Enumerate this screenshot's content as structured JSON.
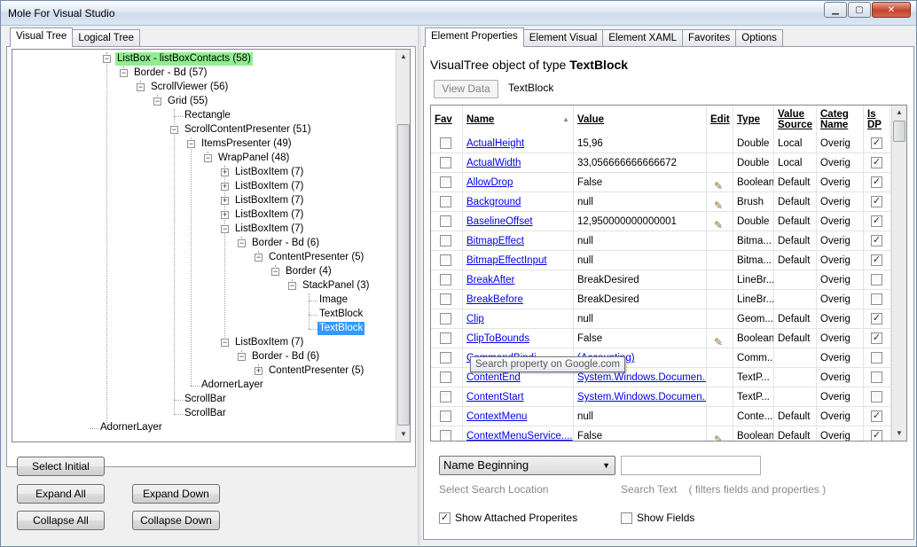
{
  "window": {
    "title": "Mole For Visual Studio",
    "minimize": "▁",
    "maximize": "▢",
    "close": "✕"
  },
  "left": {
    "tabs": [
      "Visual Tree",
      "Logical Tree"
    ],
    "tree": [
      {
        "label": "ListBox - listBoxContacts (58)",
        "depth": 0,
        "expander": "-",
        "style": "green"
      },
      {
        "label": "Border - Bd (57)",
        "depth": 1,
        "expander": "-"
      },
      {
        "label": "ScrollViewer (56)",
        "depth": 2,
        "expander": "-"
      },
      {
        "label": "Grid (55)",
        "depth": 3,
        "expander": "-"
      },
      {
        "label": "Rectangle",
        "depth": 4,
        "expander": ""
      },
      {
        "label": "ScrollContentPresenter (51)",
        "depth": 4,
        "expander": "-"
      },
      {
        "label": "ItemsPresenter (49)",
        "depth": 5,
        "expander": "-"
      },
      {
        "label": "WrapPanel (48)",
        "depth": 6,
        "expander": "-"
      },
      {
        "label": "ListBoxItem (7)",
        "depth": 7,
        "expander": "+"
      },
      {
        "label": "ListBoxItem (7)",
        "depth": 7,
        "expander": "+"
      },
      {
        "label": "ListBoxItem (7)",
        "depth": 7,
        "expander": "+"
      },
      {
        "label": "ListBoxItem (7)",
        "depth": 7,
        "expander": "+"
      },
      {
        "label": "ListBoxItem (7)",
        "depth": 7,
        "expander": "-"
      },
      {
        "label": "Border - Bd (6)",
        "depth": 8,
        "expander": "-"
      },
      {
        "label": "ContentPresenter (5)",
        "depth": 9,
        "expander": "-"
      },
      {
        "label": "Border (4)",
        "depth": 10,
        "expander": "-"
      },
      {
        "label": "StackPanel (3)",
        "depth": 11,
        "expander": "-"
      },
      {
        "label": "Image",
        "depth": 12,
        "expander": ""
      },
      {
        "label": "TextBlock",
        "depth": 12,
        "expander": ""
      },
      {
        "label": "TextBlock",
        "depth": 12,
        "expander": "",
        "style": "selected"
      },
      {
        "label": "ListBoxItem (7)",
        "depth": 7,
        "expander": "-"
      },
      {
        "label": "Border - Bd (6)",
        "depth": 8,
        "expander": "-"
      },
      {
        "label": "ContentPresenter (5)",
        "depth": 9,
        "expander": "+"
      },
      {
        "label": "AdornerLayer",
        "depth": 5,
        "expander": ""
      },
      {
        "label": "ScrollBar",
        "depth": 4,
        "expander": ""
      },
      {
        "label": "ScrollBar",
        "depth": 4,
        "expander": ""
      },
      {
        "label": "AdornerLayer",
        "depth": -1,
        "expander": ""
      }
    ],
    "buttons": {
      "select_initial": "Select Initial",
      "expand_all": "Expand All",
      "expand_down": "Expand Down",
      "collapse_all": "Collapse All",
      "collapse_down": "Collapse Down"
    }
  },
  "right": {
    "tabs": [
      "Element Properties",
      "Element Visual",
      "Element XAML",
      "Favorites",
      "Options"
    ],
    "header_prefix": "VisualTree object of type ",
    "header_type": "TextBlock",
    "view_data": "View Data",
    "type_label": "TextBlock",
    "columns": {
      "fav": "Fav",
      "name": "Name",
      "value": "Value",
      "edit": "Edit",
      "type": "Type",
      "value_source": "Value Source",
      "category_name": "Categ Name",
      "is_dp": "Is DP"
    },
    "rows": [
      {
        "name": "ActualHeight",
        "value": "15,96",
        "edit": false,
        "type": "Double",
        "source": "Local",
        "category": "Overig",
        "dp": true
      },
      {
        "name": "ActualWidth",
        "value": "33,056666666666672",
        "edit": false,
        "type": "Double",
        "source": "Local",
        "category": "Overig",
        "dp": true
      },
      {
        "name": "AllowDrop",
        "value": "False",
        "edit": true,
        "type": "Boolean",
        "source": "Default",
        "category": "Overig",
        "dp": true
      },
      {
        "name": "Background",
        "value": "null",
        "edit": true,
        "type": "Brush",
        "source": "Default",
        "category": "Overig",
        "dp": true
      },
      {
        "name": "BaselineOffset",
        "value": "12,950000000000001",
        "edit": true,
        "type": "Double",
        "source": "Default",
        "category": "Overig",
        "dp": true
      },
      {
        "name": "BitmapEffect",
        "value": "null",
        "edit": false,
        "type": "Bitma...",
        "source": "Default",
        "category": "Overig",
        "dp": true
      },
      {
        "name": "BitmapEffectInput",
        "value": "null",
        "edit": false,
        "type": "Bitma...",
        "source": "Default",
        "category": "Overig",
        "dp": true
      },
      {
        "name": "BreakAfter",
        "value": "BreakDesired",
        "edit": false,
        "type": "LineBr...",
        "source": "",
        "category": "Overig",
        "dp": false
      },
      {
        "name": "BreakBefore",
        "value": "BreakDesired",
        "edit": false,
        "type": "LineBr...",
        "source": "",
        "category": "Overig",
        "dp": false
      },
      {
        "name": "Clip",
        "value": "null",
        "edit": false,
        "type": "Geom...",
        "source": "Default",
        "category": "Overig",
        "dp": true
      },
      {
        "name": "ClipToBounds",
        "value": "False",
        "edit": true,
        "type": "Boolean",
        "source": "Default",
        "category": "Overig",
        "dp": true
      },
      {
        "name": "CommandBindi...",
        "value": "(Accounting)",
        "value_link": true,
        "edit": false,
        "type": "Comm...",
        "source": "",
        "category": "Overig",
        "dp": false
      },
      {
        "name": "ContentEnd",
        "value": "System.Windows.Documen...",
        "value_link": true,
        "edit": false,
        "type": "TextP...",
        "source": "",
        "category": "Overig",
        "dp": false
      },
      {
        "name": "ContentStart",
        "value": "System.Windows.Documen...",
        "value_link": true,
        "edit": false,
        "type": "TextP...",
        "source": "",
        "category": "Overig",
        "dp": false
      },
      {
        "name": "ContextMenu",
        "value": "null",
        "edit": false,
        "type": "Conte...",
        "source": "Default",
        "category": "Overig",
        "dp": true
      },
      {
        "name": "ContextMenuService....",
        "value": "False",
        "edit": true,
        "type": "Boolean",
        "source": "Default",
        "category": "Overig",
        "dp": true
      }
    ],
    "tooltip": "Search property on Google.com",
    "search": {
      "location_value": "Name Beginning",
      "location_hint": "Select Search Location",
      "text_value": "",
      "text_hint": "Search Text    ( filters fields and properties )"
    },
    "show_attached": {
      "label": "Show Attached Properites",
      "checked": true
    },
    "show_fields": {
      "label": "Show Fields",
      "checked": false
    }
  }
}
